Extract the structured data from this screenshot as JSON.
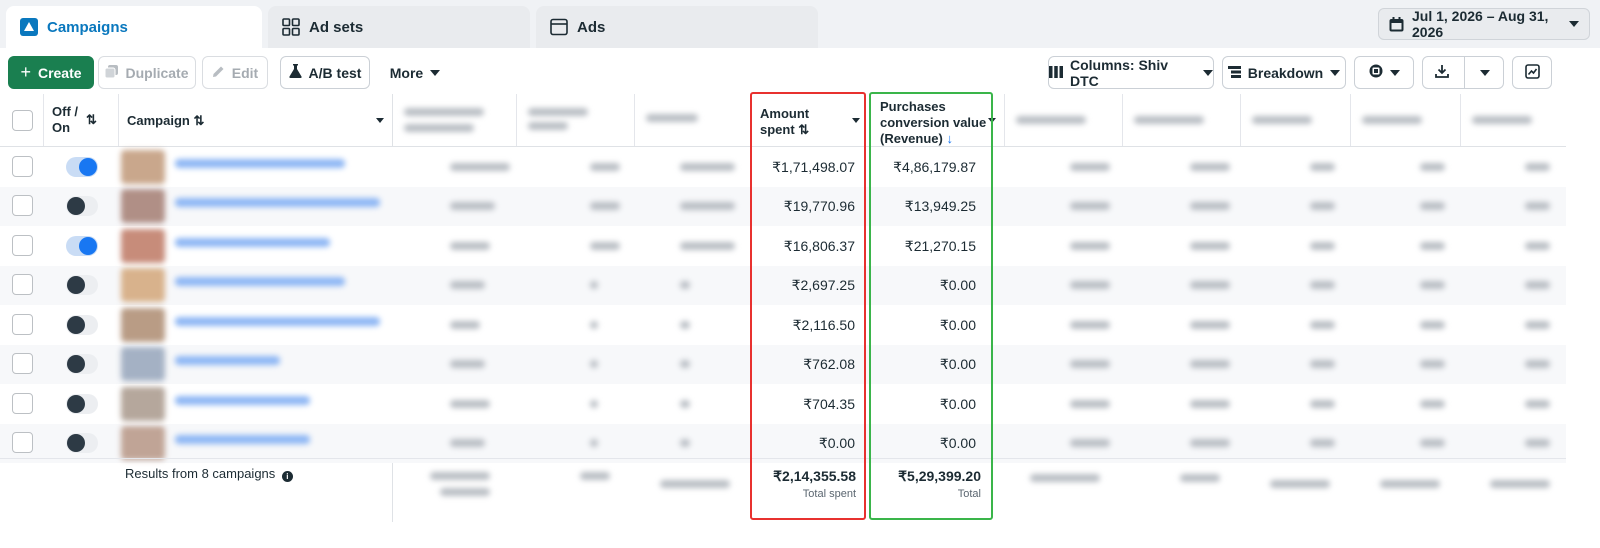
{
  "tabs": {
    "campaigns": "Campaigns",
    "ad_sets": "Ad sets",
    "ads": "Ads"
  },
  "date_range": "Jul 1, 2026 – Aug 31, 2026",
  "toolbar": {
    "create": "Create",
    "duplicate": "Duplicate",
    "edit": "Edit",
    "ab_test": "A/B test",
    "more": "More",
    "columns": "Columns: Shiv DTC",
    "breakdown": "Breakdown"
  },
  "table": {
    "headers": {
      "off_on": "Off / On",
      "campaign": "Campaign",
      "amount_spent_line1": "Amount",
      "amount_spent_line2": "spent",
      "revenue_line1": "Purchases",
      "revenue_line2": "conversion value",
      "revenue_line3": "(Revenue)"
    },
    "rows": [
      {
        "on": true,
        "amount_spent": "₹1,71,498.07",
        "revenue": "₹4,86,179.87"
      },
      {
        "on": false,
        "amount_spent": "₹19,770.96",
        "revenue": "₹13,949.25"
      },
      {
        "on": true,
        "amount_spent": "₹16,806.37",
        "revenue": "₹21,270.15"
      },
      {
        "on": false,
        "amount_spent": "₹2,697.25",
        "revenue": "₹0.00"
      },
      {
        "on": false,
        "amount_spent": "₹2,116.50",
        "revenue": "₹0.00"
      },
      {
        "on": false,
        "amount_spent": "₹762.08",
        "revenue": "₹0.00"
      },
      {
        "on": false,
        "amount_spent": "₹704.35",
        "revenue": "₹0.00"
      },
      {
        "on": false,
        "amount_spent": "₹0.00",
        "revenue": "₹0.00"
      }
    ],
    "footer": {
      "results": "Results from 8 campaigns",
      "total_spent_value": "₹2,14,355.58",
      "total_spent_label": "Total spent",
      "total_revenue_value": "₹5,29,399.20",
      "total_revenue_label": "Total"
    }
  },
  "colors": {
    "accent": "#0a78be",
    "create_green": "#1a7f50",
    "highlight_red": "#e8312f",
    "highlight_green": "#3ab54a",
    "toggle_on": "#1877f2"
  }
}
